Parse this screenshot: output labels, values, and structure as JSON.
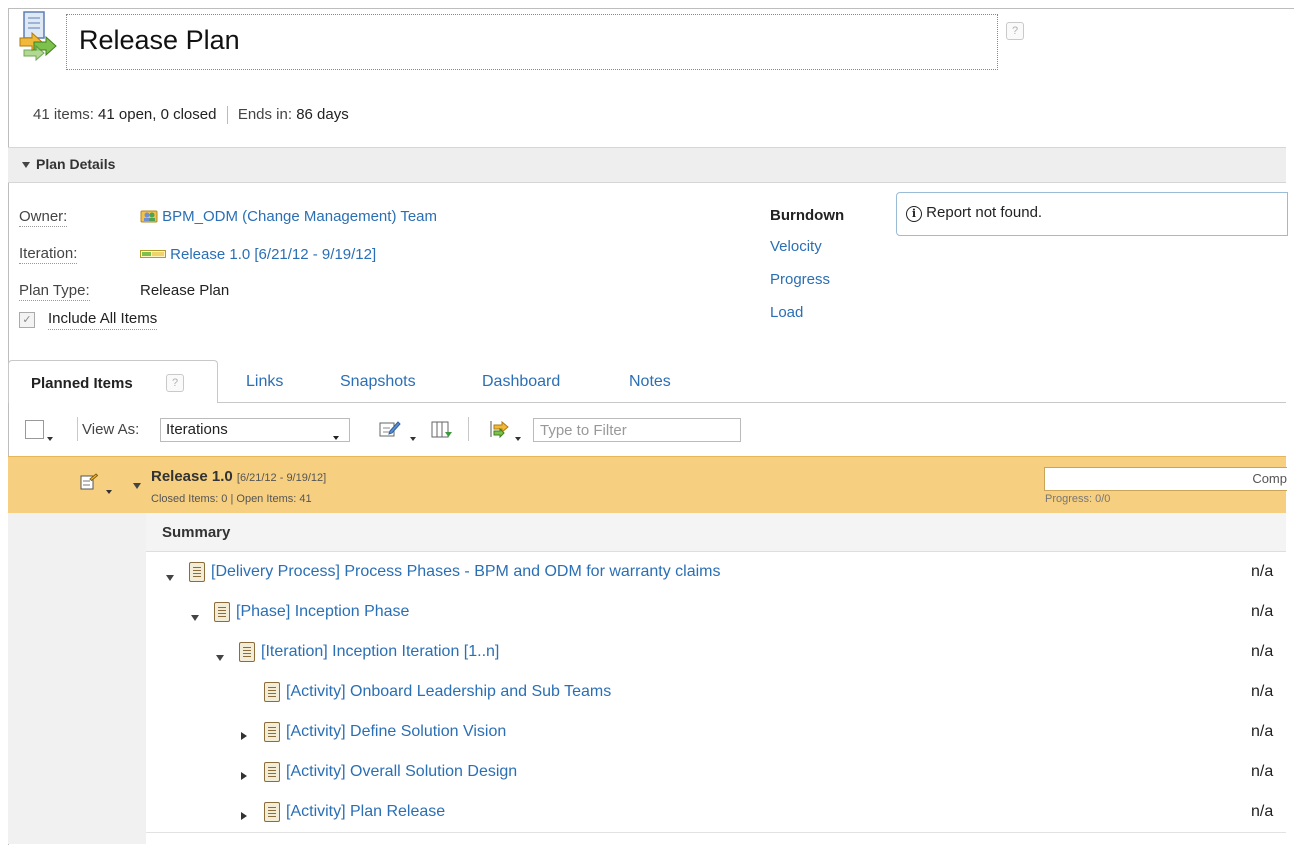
{
  "header": {
    "title": "Release Plan",
    "help_glyph": "?",
    "items_label": "41 items:",
    "items_value": "41 open, 0 closed",
    "ends_label": "Ends in:",
    "ends_value": "86 days"
  },
  "plan_details": {
    "section_label": "Plan Details",
    "owner_label": "Owner:",
    "owner_value": "BPM_ODM (Change Management) Team",
    "iteration_label": "Iteration:",
    "iteration_value": "Release 1.0 [6/21/12 - 9/19/12]",
    "plan_type_label": "Plan Type:",
    "plan_type_value": "Release Plan",
    "include_all_label": "Include All Items",
    "include_all_checked": true,
    "reports": [
      "Burndown",
      "Velocity",
      "Progress",
      "Load"
    ],
    "report_message": "Report not found."
  },
  "tabs": {
    "active": "Planned Items",
    "others": [
      "Links",
      "Snapshots",
      "Dashboard",
      "Notes"
    ]
  },
  "toolbar": {
    "view_as_label": "View As:",
    "view_as_value": "Iterations",
    "filter_placeholder": "Type to Filter"
  },
  "release": {
    "title": "Release 1.0",
    "dates": "[6/21/12 - 9/19/12]",
    "counts": "Closed Items: 0 | Open Items: 41",
    "progress_bar_label": "Comp",
    "progress_text": "Progress: 0/0"
  },
  "table": {
    "header": "Summary",
    "rows": [
      {
        "text": "[Delivery Process] Process Phases - BPM and ODM for warranty claims",
        "value": "n/a",
        "level": 0,
        "toggle": "expanded"
      },
      {
        "text": "[Phase] Inception Phase",
        "value": "n/a",
        "level": 1,
        "toggle": "expanded"
      },
      {
        "text": "[Iteration] Inception Iteration [1..n]",
        "value": "n/a",
        "level": 2,
        "toggle": "expanded"
      },
      {
        "text": "[Activity] Onboard Leadership and Sub Teams",
        "value": "n/a",
        "level": 3,
        "toggle": "none"
      },
      {
        "text": "[Activity] Define Solution Vision",
        "value": "n/a",
        "level": 3,
        "toggle": "collapsed"
      },
      {
        "text": "[Activity] Overall Solution Design",
        "value": "n/a",
        "level": 3,
        "toggle": "collapsed"
      },
      {
        "text": "[Activity] Plan Release",
        "value": "n/a",
        "level": 3,
        "toggle": "collapsed"
      }
    ]
  },
  "icons": [
    "plan-arrows-icon",
    "team-icon",
    "iteration-bar-icon",
    "edit-icon",
    "columns-icon",
    "filter-arrows-icon",
    "info-icon",
    "work-item-icon"
  ]
}
